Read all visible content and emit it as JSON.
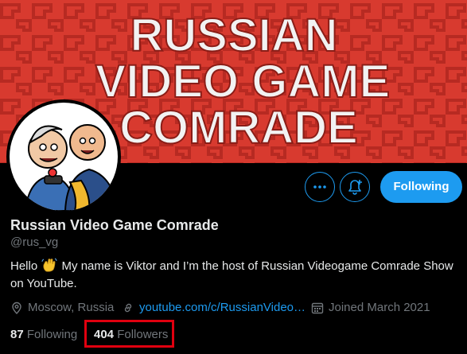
{
  "banner": {
    "title_lines": [
      "RUSSIAN",
      "VIDEO GAME",
      "COMRADE"
    ],
    "background_color": "#d83a2f",
    "pattern_color": "#b72a22",
    "text_color": "#f2f2f2"
  },
  "avatar": {
    "alt_icon": "avatar-cartoon-icon"
  },
  "actions": {
    "more_icon": "more-dots-icon",
    "notify_icon": "bell-plus-icon",
    "follow_label": "Following"
  },
  "profile": {
    "name": "Russian Video Game Comrade",
    "handle": "@rus_vg",
    "bio_before": "Hello",
    "bio_after": "My name is Viktor and I’m the host of Russian Videogame Comrade Show on YouTube.",
    "bio_emoji": "waving-hand-icon"
  },
  "meta": {
    "location": "Moscow, Russia",
    "website": "youtube.com/c/RussianVideo…",
    "joined": "Joined March 2021"
  },
  "stats": {
    "following_count": "87",
    "following_label": "Following",
    "followers_count": "404",
    "followers_label": "Followers"
  },
  "colors": {
    "accent": "#1d9bf0",
    "muted": "#71767b",
    "text": "#e7e9ea",
    "highlight": "#e0000f"
  }
}
